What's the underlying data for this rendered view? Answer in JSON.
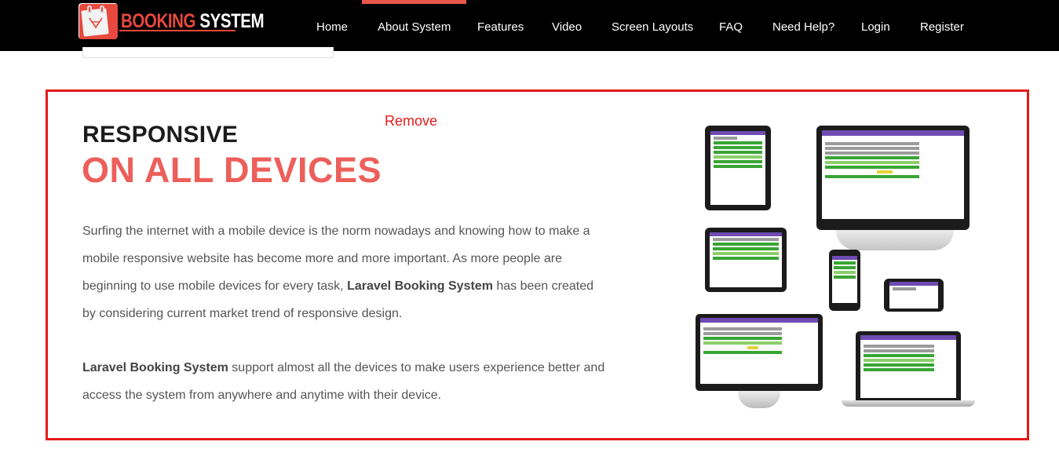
{
  "brand": {
    "logo_text_accent": "BOOKING",
    "logo_text_main": " SYSTEM",
    "accent_color": "#e8483d"
  },
  "nav": {
    "items": [
      {
        "label": "Home"
      },
      {
        "label": "About System",
        "active": true
      },
      {
        "label": "Features"
      },
      {
        "label": "Video"
      },
      {
        "label": "Screen Layouts"
      },
      {
        "label": "FAQ"
      },
      {
        "label": "Need Help?"
      },
      {
        "label": "Login"
      },
      {
        "label": "Register"
      }
    ]
  },
  "section": {
    "remove_label": "Remove",
    "title_line1": "RESPONSIVE",
    "title_line2": "ON ALL DEVICES",
    "paragraph1": {
      "before": "Surfing the internet with a mobile device is the norm nowadays and knowing how to make a mobile responsive website has become more and more important. As more people are beginning to use mobile devices for every task, ",
      "bold": "Laravel Booking System",
      "after": " has been created by considering current market trend of responsive design."
    },
    "paragraph2": {
      "bold": "Laravel Booking System",
      "after": " support almost all the devices to make users experience better and access the system from anywhere and anytime with their device."
    },
    "border_color": "#e51a1a",
    "title_accent_color": "#ec5f5a"
  }
}
